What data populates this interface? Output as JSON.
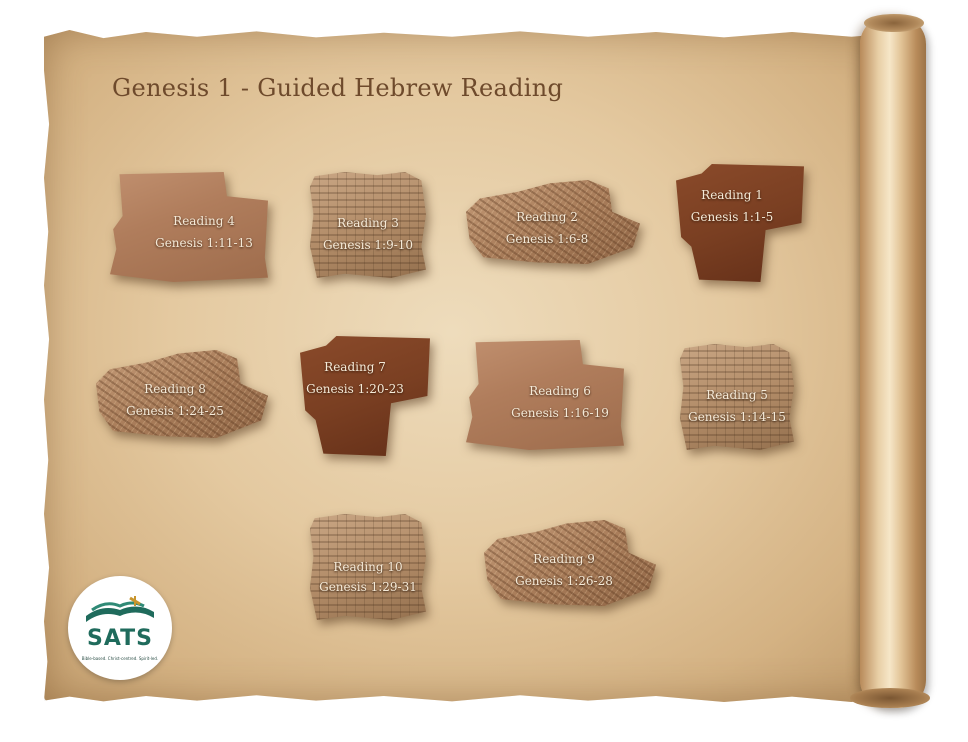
{
  "page": {
    "title": "Genesis 1 - Guided Hebrew Reading"
  },
  "readings": [
    {
      "id": "reading-4",
      "label": "Reading 4",
      "ref": "Genesis 1:11-13",
      "texture": "smooth"
    },
    {
      "id": "reading-3",
      "label": "Reading 3",
      "ref": "Genesis 1:9-10",
      "texture": "paper"
    },
    {
      "id": "reading-2",
      "label": "Reading 2",
      "ref": "Genesis 1:6-8",
      "texture": "texture"
    },
    {
      "id": "reading-1",
      "label": "Reading 1",
      "ref": "Genesis 1:1-5",
      "texture": "dark"
    },
    {
      "id": "reading-8",
      "label": "Reading 8",
      "ref": "Genesis 1:24-25",
      "texture": "texture"
    },
    {
      "id": "reading-7",
      "label": "Reading 7",
      "ref": "Genesis 1:20-23",
      "texture": "dark"
    },
    {
      "id": "reading-6",
      "label": "Reading 6",
      "ref": "Genesis 1:16-19",
      "texture": "smooth"
    },
    {
      "id": "reading-5",
      "label": "Reading 5",
      "ref": "Genesis 1:14-15",
      "texture": "paper"
    },
    {
      "id": "reading-10",
      "label": "Reading 10",
      "ref": "Genesis 1:29-31",
      "texture": "paper"
    },
    {
      "id": "reading-9",
      "label": "Reading 9",
      "ref": "Genesis 1:26-28",
      "texture": "texture"
    }
  ],
  "logo": {
    "name": "SATS",
    "tagline": "Bible-based. Christ-centred. Spirit-led.",
    "color": "#1f6b5c"
  }
}
